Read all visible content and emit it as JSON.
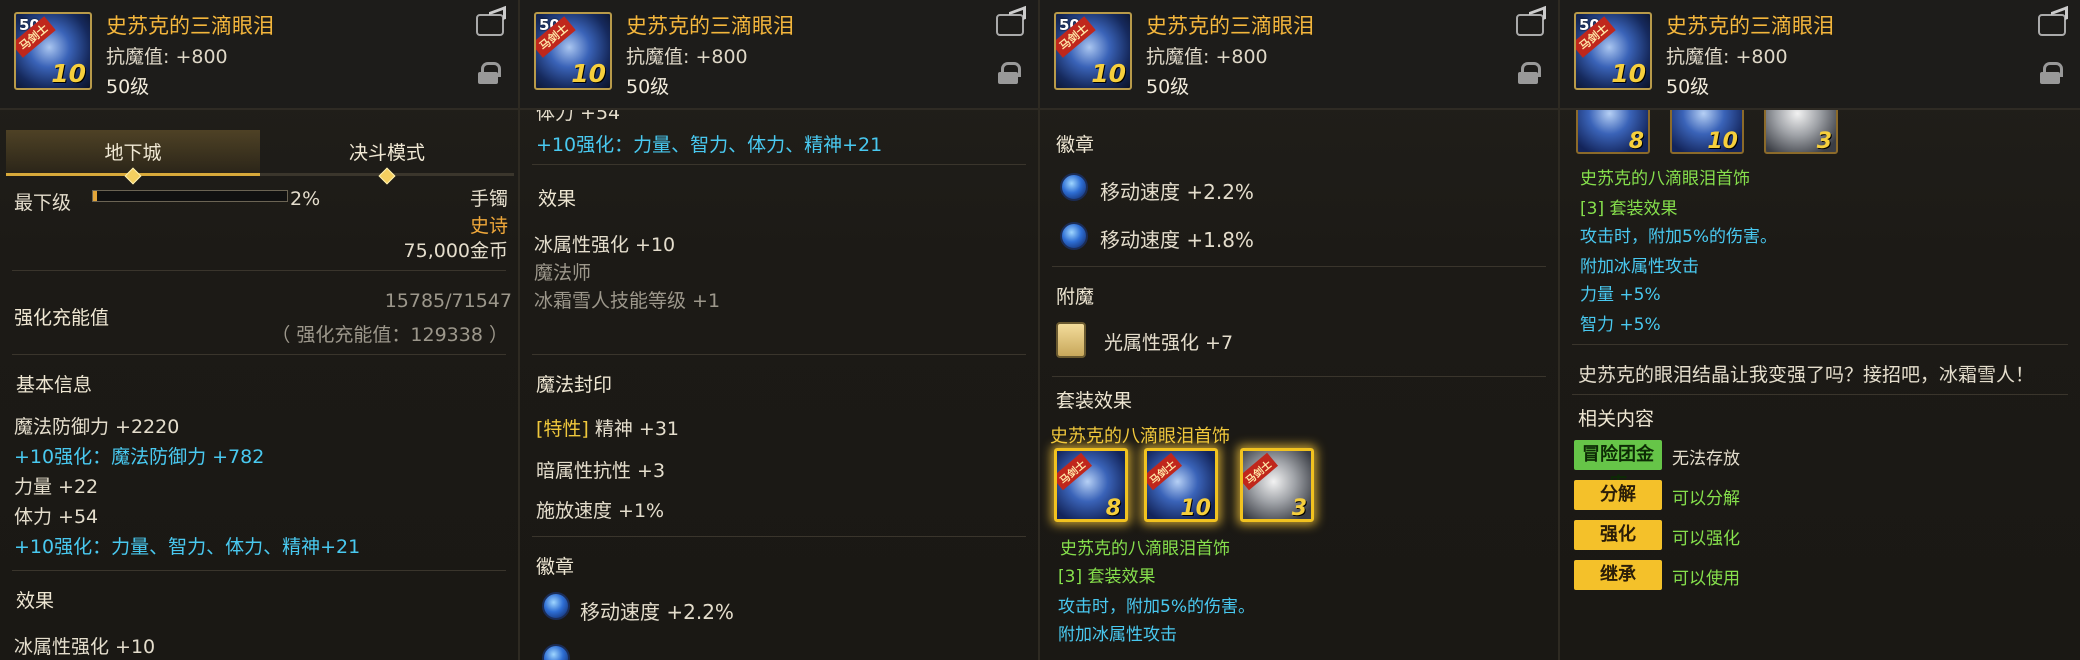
{
  "item": {
    "name": "史苏克的三滴眼泪",
    "stat": "抗魔值: +800",
    "level": "50级",
    "badge": "马剑士",
    "enhance": "10",
    "item_level": "50"
  },
  "panel1": {
    "tabs": [
      "地下城",
      "决斗模式"
    ],
    "drop": {
      "label": "最下级",
      "percent": "2%",
      "progress": 0.02
    },
    "slot": "手镯",
    "rarity": "史诗",
    "price": "75,000金币",
    "amplify": {
      "label": "强化充能值",
      "value": "15785/71547",
      "note": "（ 强化充能值：129338 ）"
    },
    "basic_title": "基本信息",
    "basic": [
      {
        "text": "魔法防御力 +2220",
        "color": "w"
      },
      {
        "text": "+10强化：魔法防御力 +782",
        "color": "c"
      },
      {
        "text": "力量 +22",
        "color": "w"
      },
      {
        "text": "体力 +54",
        "color": "w"
      },
      {
        "text": "+10强化：力量、智力、体力、精神+21",
        "color": "c"
      }
    ],
    "effect_title": "效果",
    "effect_cut": "冰属性强化 +10"
  },
  "panel2": {
    "top_cut": "体力 +54",
    "enhance_line": "+10强化：力量、智力、体力、精神+21",
    "effect_title": "效果",
    "effects": [
      "冰属性强化 +10",
      "魔法师",
      "冰霜雪人技能等级 +1"
    ],
    "seal_title": "魔法封印",
    "seal_trait_tag": "[特性]",
    "seal_trait": "精神 +31",
    "seals": [
      "暗属性抗性 +3",
      "施放速度 +1%"
    ],
    "emblem_title": "徽章",
    "emblem": "移动速度 +2.2%"
  },
  "panel3": {
    "emblem_title": "徽章",
    "emblems": [
      "移动速度 +2.2%",
      "移动速度 +1.8%"
    ],
    "enchant_title": "附魔",
    "enchant": "光属性强化 +7",
    "set_title": "套装效果",
    "set_name": "史苏克的八滴眼泪首饰",
    "set_items": [
      "8",
      "10",
      "3"
    ],
    "set_name2": "史苏克的八滴眼泪首饰",
    "set_bonus": "[3] 套装效果",
    "set_lines": [
      "攻击时，附加5%的伤害。",
      "附加冰属性攻击"
    ]
  },
  "panel4": {
    "set_items": [
      "8",
      "10",
      "3"
    ],
    "set_name": "史苏克的八滴眼泪首饰",
    "set_bonus": "[3] 套装效果",
    "set_lines": [
      "攻击时，附加5%的伤害。",
      "附加冰属性攻击",
      "力量 +5%",
      "智力 +5%"
    ],
    "flavor": "史苏克的眼泪结晶让我变强了吗？接招吧，冰霜雪人！",
    "related_title": "相关内容",
    "related": [
      {
        "button": "冒险团金库",
        "status": "无法存放",
        "style": "green"
      },
      {
        "button": "分解",
        "status": "可以分解",
        "style": "gold"
      },
      {
        "button": "强化",
        "status": "可以强化",
        "style": "gold"
      },
      {
        "button": "继承",
        "status": "可以使用",
        "style": "gold"
      }
    ]
  }
}
